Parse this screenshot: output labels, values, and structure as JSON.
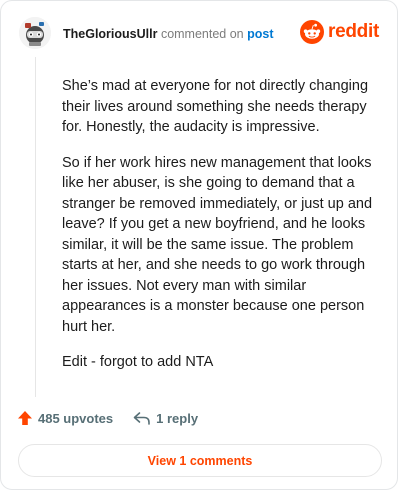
{
  "header": {
    "username": "TheGloriousUllr",
    "action_text": "commented on",
    "post_link": "post"
  },
  "logo": {
    "word": "reddit"
  },
  "comment": {
    "paragraphs": [
      "She’s mad at everyone for not directly changing their lives around something she needs therapy for. Honestly, the audacity is impressive.",
      "So if her work hires new management that looks like her abuser, is she going to demand that a stranger be removed immediately, or just up and leave? If you get a new boyfriend, and he looks similar, it will be the same issue. The problem starts at her, and she needs to go work through her issues. Not every man with similar appearances is a monster because one person hurt her.",
      "Edit - forgot to add NTA"
    ]
  },
  "actions": {
    "upvotes_label": "485 upvotes",
    "replies_label": "1 reply"
  },
  "footer": {
    "view_button": "View 1 comments"
  },
  "colors": {
    "brand": "#ff4500",
    "link": "#0079d3",
    "muted": "#576f76"
  },
  "icons": [
    "avatar",
    "reddit-snoo-icon",
    "upvote-arrow-icon",
    "reply-icon"
  ]
}
